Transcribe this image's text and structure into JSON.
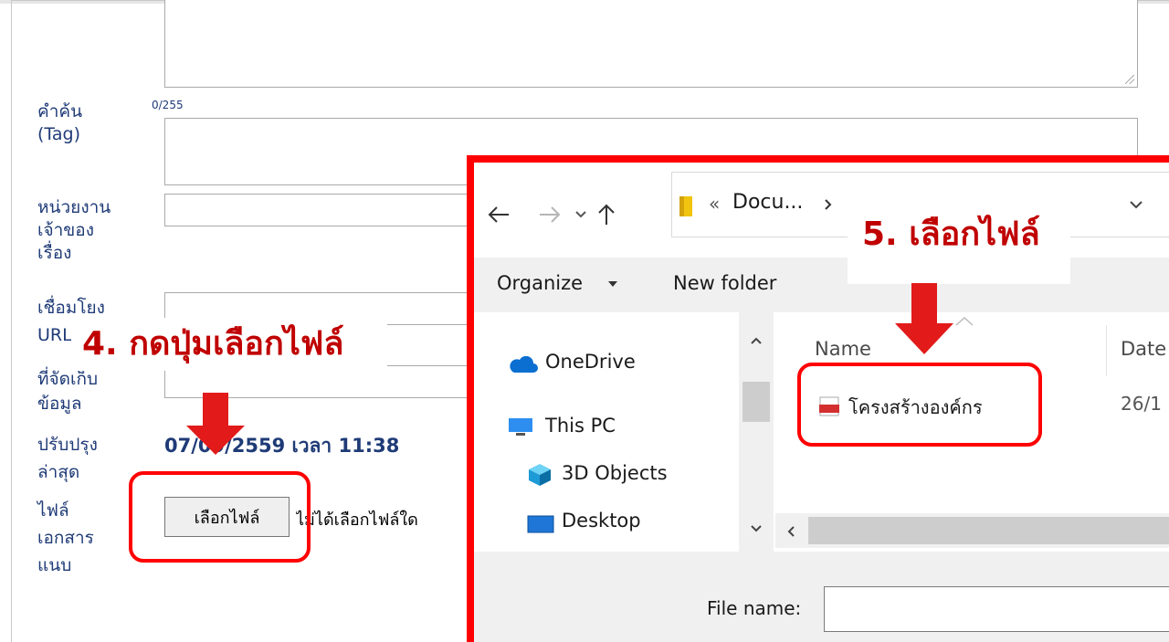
{
  "form": {
    "counter": "0/255",
    "labels": {
      "tag_line1": "คำค้น",
      "tag_line2": "(Tag)",
      "owner_line1": "หน่วยงาน",
      "owner_line2": "เจ้าของ",
      "owner_line3": "เรื่อง",
      "link_line1": "เชื่อมโยง",
      "link_line2": "URL",
      "source_line1": "ที่จัดเก็บ",
      "source_line2": "ข้อมูล",
      "updated_line1": "ปรับปรุง",
      "updated_line2": "ล่าสุด",
      "attach_line1": "ไฟล์",
      "attach_line2": "เอกสาร",
      "attach_line3": "แนบ"
    },
    "updated_value": "07/09/2559 เวลา 11:38",
    "file_button": "เลือกไฟล์",
    "no_file_text": "ไม่ได้เลือกไฟล์ใด"
  },
  "annotations": {
    "step4": "4. กดปุ่มเลือกไฟล์",
    "step5": "5. เลือกไฟล์",
    "accent": "#ff0000"
  },
  "dialog": {
    "breadcrumb_prefix": "«",
    "breadcrumb": "Docu...",
    "organize": "Organize",
    "new_folder": "New folder",
    "nav_items": {
      "onedrive": "OneDrive",
      "this_pc": "This PC",
      "objects3d": "3D Objects",
      "desktop": "Desktop"
    },
    "columns": {
      "name": "Name",
      "date": "Date"
    },
    "file": {
      "name": "โครงสร้างองค์กร",
      "date": "26/1"
    },
    "file_name_label": "File name:"
  }
}
